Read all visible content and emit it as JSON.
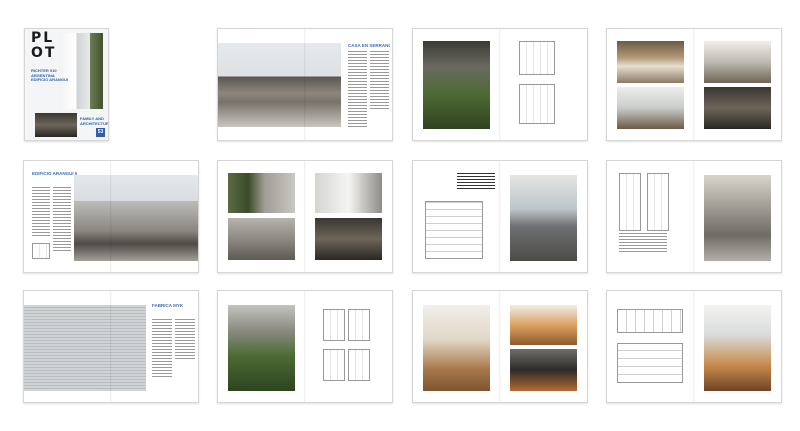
{
  "cover": {
    "logo": "PL\nOT",
    "headline": "RICHTER 910\nARGENTINA\nEDIFICIO ARANGUI",
    "bottom_text": "FAMILY AND\nARCHITECTURE",
    "issue_number": "53"
  },
  "spreads": [
    {
      "title": "CASA EN SERRANO"
    },
    {
      "title": ""
    },
    {
      "title": ""
    },
    {
      "title": "EDIFICIO ARANGUI 578"
    },
    {
      "title": ""
    },
    {
      "title": ""
    },
    {
      "title": ""
    },
    {
      "title": "FABRICA MYK"
    },
    {
      "title": ""
    },
    {
      "title": ""
    },
    {
      "title": ""
    }
  ]
}
